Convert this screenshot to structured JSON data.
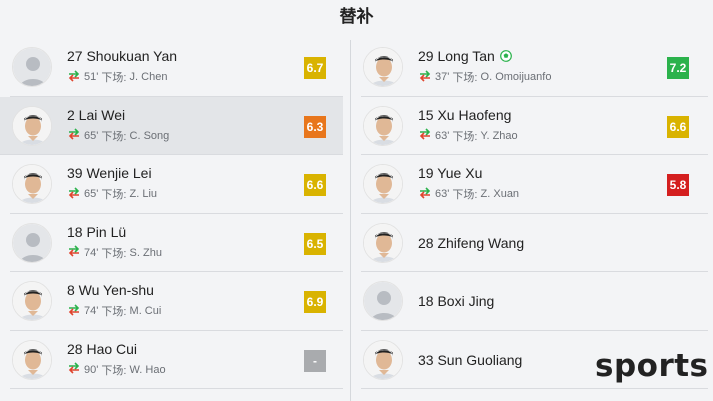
{
  "header": {
    "title": "替补"
  },
  "colors": {
    "green": "#2bb24c",
    "yellow": "#d9b300",
    "orange": "#e8761c",
    "red": "#d41f1f",
    "gray": "#a9abae"
  },
  "left": [
    {
      "number_name": "27 Shoukuan Yan",
      "minute": "51'",
      "sub_label": "下场:",
      "sub_player": "J. Chen",
      "rating": "6.7",
      "rating_color": "#d9b300",
      "avatar": "placeholder",
      "highlight": false
    },
    {
      "number_name": "2 Lai Wei",
      "minute": "65'",
      "sub_label": "下场:",
      "sub_player": "C. Song",
      "rating": "6.3",
      "rating_color": "#e8761c",
      "avatar": "photo",
      "highlight": true
    },
    {
      "number_name": "39 Wenjie Lei",
      "minute": "65'",
      "sub_label": "下场:",
      "sub_player": "Z. Liu",
      "rating": "6.6",
      "rating_color": "#d9b300",
      "avatar": "photo",
      "highlight": false
    },
    {
      "number_name": "18 Pin Lü",
      "minute": "74'",
      "sub_label": "下场:",
      "sub_player": "S. Zhu",
      "rating": "6.5",
      "rating_color": "#d9b300",
      "avatar": "placeholder",
      "highlight": false
    },
    {
      "number_name": "8 Wu Yen-shu",
      "minute": "74'",
      "sub_label": "下场:",
      "sub_player": "M. Cui",
      "rating": "6.9",
      "rating_color": "#d9b300",
      "avatar": "photo",
      "highlight": false
    },
    {
      "number_name": "28 Hao Cui",
      "minute": "90'",
      "sub_label": "下场:",
      "sub_player": "W. Hao",
      "rating": "-",
      "rating_color": "#a9abae",
      "avatar": "photo",
      "highlight": false
    }
  ],
  "right": [
    {
      "number_name": "29 Long Tan",
      "minute": "37'",
      "sub_label": "下场:",
      "sub_player": "O. Omoijuanfo",
      "rating": "7.2",
      "rating_color": "#2bb24c",
      "avatar": "photo",
      "goal": true
    },
    {
      "number_name": "15 Xu Haofeng",
      "minute": "63'",
      "sub_label": "下场:",
      "sub_player": "Y. Zhao",
      "rating": "6.6",
      "rating_color": "#d9b300",
      "avatar": "photo"
    },
    {
      "number_name": "19 Yue Xu",
      "minute": "63'",
      "sub_label": "下场:",
      "sub_player": "Z. Xuan",
      "rating": "5.8",
      "rating_color": "#d41f1f",
      "avatar": "photo"
    },
    {
      "number_name": "28 Zhifeng Wang",
      "avatar": "photo"
    },
    {
      "number_name": "18 Boxi Jing",
      "avatar": "placeholder"
    },
    {
      "number_name": "33 Sun Guoliang",
      "avatar": "photo"
    }
  ],
  "watermark": "sports"
}
